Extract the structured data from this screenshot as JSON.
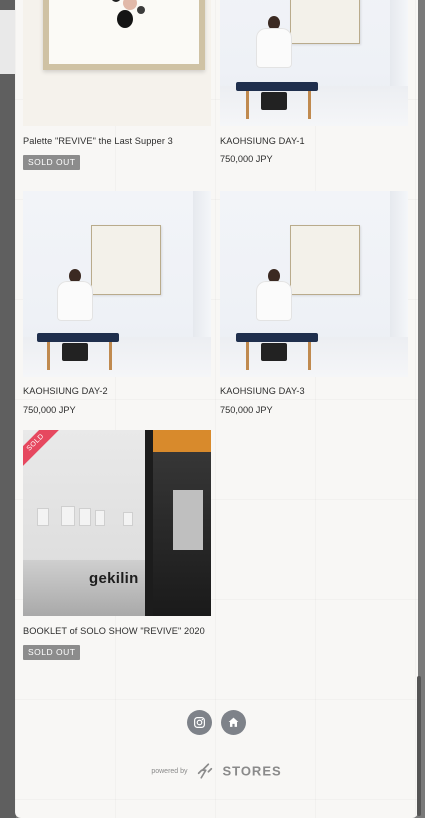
{
  "products": [
    {
      "name": "Palette \"REVIVE\" the Last Supper 3",
      "price": "",
      "badge": "SOLD OUT",
      "image": "palette-painting"
    },
    {
      "name": "KAOHSIUNG DAY-1",
      "price": "750,000 JPY",
      "badge": "",
      "image": "gallery-bench-scene"
    },
    {
      "name": "KAOHSIUNG DAY-2",
      "price": "750,000 JPY",
      "badge": "",
      "image": "gallery-bench-scene"
    },
    {
      "name": "KAOHSIUNG DAY-3",
      "price": "750,000 JPY",
      "badge": "",
      "image": "gallery-bench-scene"
    },
    {
      "name": "BOOKLET of SOLO SHOW \"REVIVE\" 2020",
      "price": "",
      "badge": "SOLD OUT",
      "ribbon": "SOLD",
      "image_text": "gekilin"
    }
  ],
  "footer": {
    "social_icons": [
      "instagram-icon",
      "home-icon"
    ],
    "powered_by": "powered by",
    "brand": "STORES"
  },
  "colors": {
    "badge_bg": "#8c8c8c",
    "ribbon": "#e6485f",
    "bench": "#1f2f4d",
    "icon_bg": "#7e8289"
  }
}
